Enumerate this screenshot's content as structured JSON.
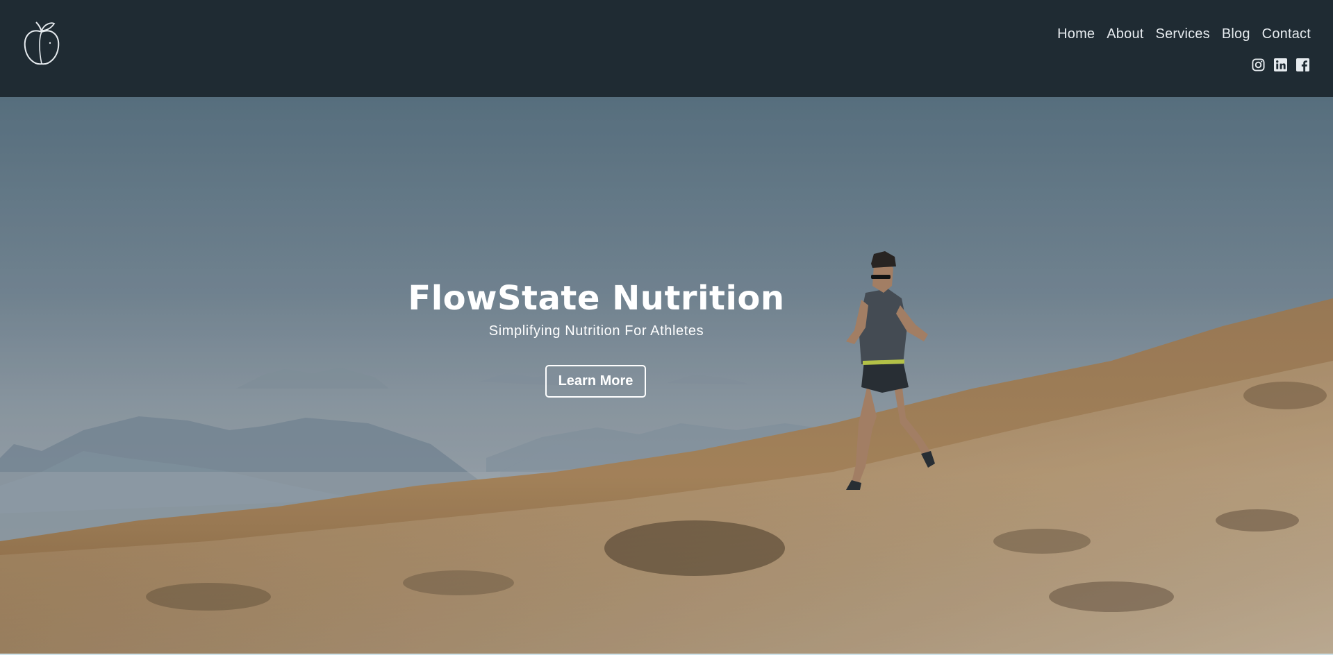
{
  "header": {
    "logo": {
      "icon": "peach-icon"
    },
    "nav": [
      {
        "label": "Home"
      },
      {
        "label": "About"
      },
      {
        "label": "Services"
      },
      {
        "label": "Blog"
      },
      {
        "label": "Contact"
      }
    ],
    "social": [
      {
        "icon": "instagram-icon"
      },
      {
        "icon": "linkedin-icon"
      },
      {
        "icon": "facebook-icon"
      }
    ]
  },
  "hero": {
    "title": "FlowState Nutrition",
    "subtitle": "Simplifying Nutrition For Athletes",
    "cta_label": "Learn More"
  },
  "colors": {
    "header_bg": "#1f2b33",
    "nav_text": "#e6ebef",
    "hero_text": "#ffffff"
  }
}
